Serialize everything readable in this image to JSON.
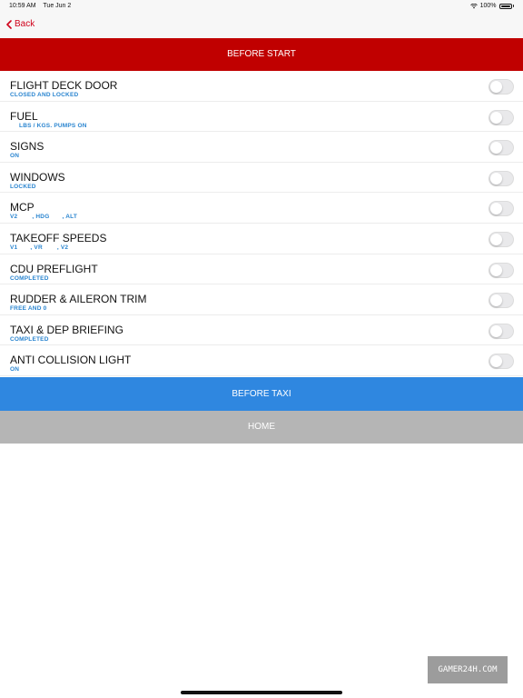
{
  "status": {
    "time": "10:59 AM",
    "date": "Tue Jun 2",
    "battery": "100%"
  },
  "nav": {
    "back_label": "Back"
  },
  "header": {
    "title": "BEFORE START"
  },
  "items": [
    {
      "title": "FLIGHT DECK DOOR",
      "sub": "CLOSED AND LOCKED",
      "checked": false
    },
    {
      "title": "FUEL",
      "sub": "     LBS / KGS. PUMPS ON",
      "checked": false
    },
    {
      "title": "SIGNS",
      "sub": "ON",
      "checked": false
    },
    {
      "title": "WINDOWS",
      "sub": "LOCKED",
      "checked": false
    },
    {
      "title": "MCP",
      "sub": "V2        , HDG       , ALT",
      "checked": false
    },
    {
      "title": "TAKEOFF SPEEDS",
      "sub": "V1       , VR        , V2",
      "checked": false
    },
    {
      "title": "CDU PREFLIGHT",
      "sub": "COMPLETED",
      "checked": false
    },
    {
      "title": "RUDDER & AILERON TRIM",
      "sub": "FREE AND 0",
      "checked": false
    },
    {
      "title": "TAXI & DEP BRIEFING",
      "sub": "COMPLETED",
      "checked": false
    },
    {
      "title": "ANTI COLLISION LIGHT",
      "sub": "ON",
      "checked": false
    }
  ],
  "buttons": {
    "next_label": "BEFORE TAXI",
    "home_label": "HOME"
  },
  "watermark": "GAMER24H.COM",
  "colors": {
    "header": "#c00000",
    "accent": "#d0021b",
    "subtitle": "#2a85d0",
    "next_button": "#2f87e0",
    "home_button": "#b5b5b5"
  }
}
